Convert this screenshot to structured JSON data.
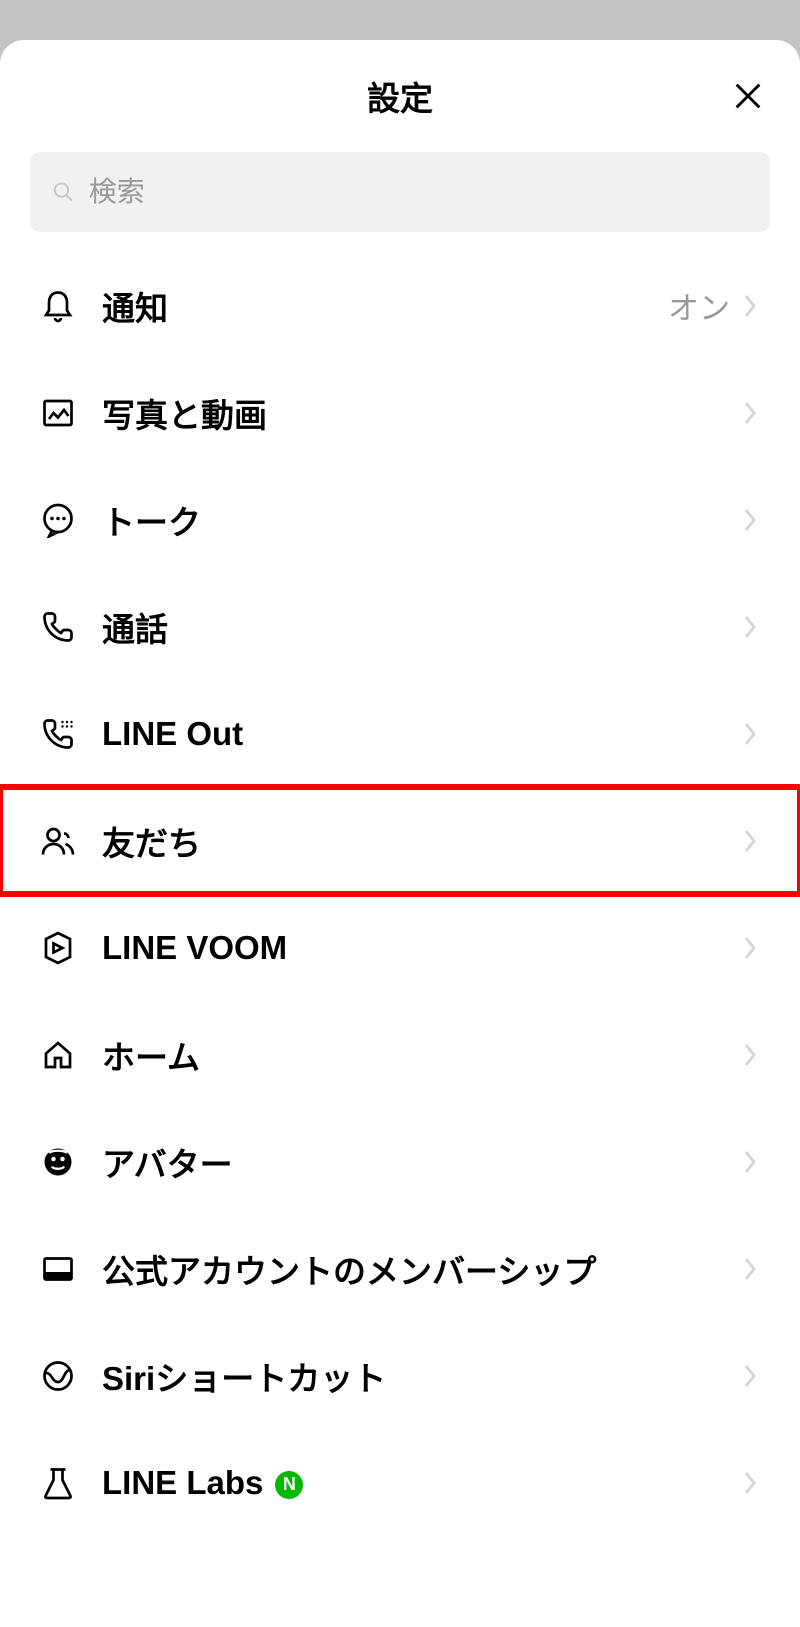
{
  "header": {
    "title": "設定"
  },
  "search": {
    "placeholder": "検索"
  },
  "items": [
    {
      "label": "通知",
      "value": "オン",
      "icon": "bell",
      "highlighted": false,
      "badge": null
    },
    {
      "label": "写真と動画",
      "value": "",
      "icon": "photo",
      "highlighted": false,
      "badge": null
    },
    {
      "label": "トーク",
      "value": "",
      "icon": "chat",
      "highlighted": false,
      "badge": null
    },
    {
      "label": "通話",
      "value": "",
      "icon": "phone",
      "highlighted": false,
      "badge": null
    },
    {
      "label": "LINE Out",
      "value": "",
      "icon": "phone-out",
      "highlighted": false,
      "badge": null
    },
    {
      "label": "友だち",
      "value": "",
      "icon": "friends",
      "highlighted": true,
      "badge": null
    },
    {
      "label": "LINE VOOM",
      "value": "",
      "icon": "voom",
      "highlighted": false,
      "badge": null
    },
    {
      "label": "ホーム",
      "value": "",
      "icon": "home",
      "highlighted": false,
      "badge": null
    },
    {
      "label": "アバター",
      "value": "",
      "icon": "avatar",
      "highlighted": false,
      "badge": null
    },
    {
      "label": "公式アカウントのメンバーシップ",
      "value": "",
      "icon": "membership",
      "highlighted": false,
      "badge": null
    },
    {
      "label": "Siriショートカット",
      "value": "",
      "icon": "siri",
      "highlighted": false,
      "badge": null
    },
    {
      "label": "LINE Labs",
      "value": "",
      "icon": "labs",
      "highlighted": false,
      "badge": "N"
    }
  ]
}
